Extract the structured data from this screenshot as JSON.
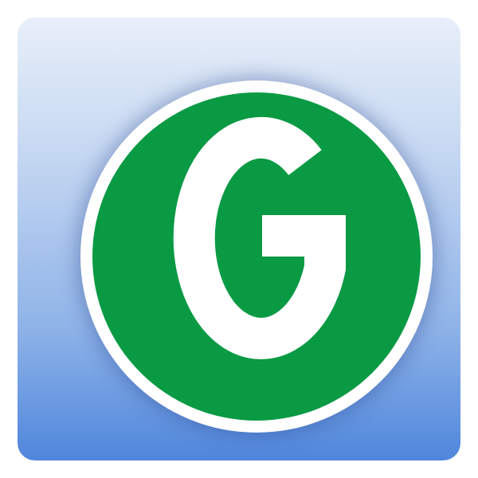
{
  "sign": {
    "letter": "G",
    "disc_color": "#0a9a44",
    "ring_color": "#ffffff",
    "background_gradient": [
      "#e8eff9",
      "#4f86dc"
    ]
  }
}
